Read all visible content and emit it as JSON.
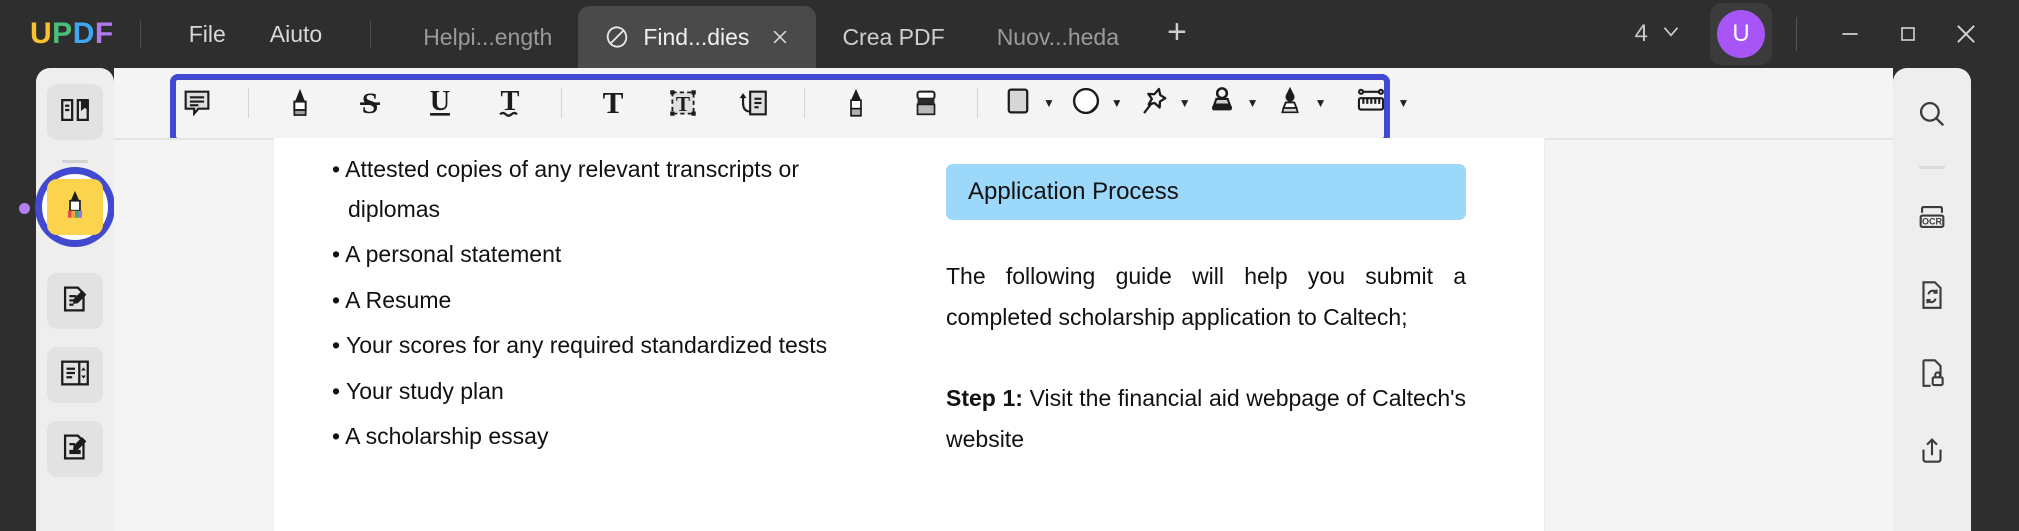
{
  "app": {
    "brand": "UPDF",
    "brand_letters": [
      "U",
      "P",
      "D",
      "F"
    ]
  },
  "titlebar": {
    "menus": [
      {
        "label": "File",
        "name": "menu-file"
      },
      {
        "label": "Aiuto",
        "name": "menu-aiuto"
      }
    ],
    "tabs": [
      {
        "label": "Helpi...ength",
        "active": false
      },
      {
        "label": "Find...dies",
        "active": true,
        "close": "✕"
      },
      {
        "label": "Crea PDF",
        "active": false
      },
      {
        "label": "Nuov...heda",
        "active": false
      }
    ],
    "new_tab_label": "+",
    "tab_count": "4",
    "tab_count_caret": "∨",
    "avatar_letter": "U",
    "window_controls": {
      "minimize": "—",
      "maximize": "□",
      "close": "✕"
    }
  },
  "left_rail": {
    "items": [
      {
        "name": "sidebar-item-reader",
        "icon": "book-bookmark-icon",
        "active": false
      },
      {
        "name": "sidebar-item-comment",
        "icon": "highlighter-marker-icon",
        "active": true
      },
      {
        "name": "sidebar-item-edit-pdf",
        "icon": "document-pen-icon",
        "active": false
      },
      {
        "name": "sidebar-item-page-tools",
        "icon": "page-organize-icon",
        "active": false
      },
      {
        "name": "sidebar-item-fill-sign",
        "icon": "form-sign-icon",
        "active": false
      }
    ]
  },
  "right_rail": {
    "items": [
      {
        "name": "search-button",
        "icon": "search-icon",
        "label": ""
      },
      {
        "name": "ocr-button",
        "icon": "ocr-icon",
        "label": "OCR"
      },
      {
        "name": "convert-button",
        "icon": "convert-document-icon",
        "label": ""
      },
      {
        "name": "protect-button",
        "icon": "document-lock-icon",
        "label": ""
      },
      {
        "name": "share-button",
        "icon": "share-upload-icon",
        "label": ""
      }
    ]
  },
  "annotation_toolbar": {
    "highlighted": true,
    "highlight_color": "#4049d0",
    "tools": [
      {
        "name": "sticky-note-tool",
        "icon": "sticky-note-icon",
        "caret": false
      },
      {
        "name": "highlight-tool",
        "icon": "highlighter-icon",
        "caret": false
      },
      {
        "name": "strikethrough-tool",
        "icon": "strikethrough-S-icon",
        "caret": false
      },
      {
        "name": "underline-tool",
        "icon": "underline-U-icon",
        "caret": false
      },
      {
        "name": "squiggly-tool",
        "icon": "squiggly-T-icon",
        "caret": false
      },
      {
        "name": "text-box-tool",
        "icon": "text-T-icon",
        "caret": false
      },
      {
        "name": "text-field-tool",
        "icon": "text-box-selected-icon",
        "caret": false
      },
      {
        "name": "text-callout-tool",
        "icon": "text-callout-icon",
        "caret": false
      },
      {
        "name": "pencil-tool",
        "icon": "pencil-icon",
        "caret": false
      },
      {
        "name": "eraser-tool",
        "icon": "eraser-icon",
        "caret": false
      },
      {
        "name": "shape-tool",
        "icon": "rectangle-shape-icon",
        "caret": true
      },
      {
        "name": "sticker-tool",
        "icon": "sticker-circle-icon",
        "caret": true
      },
      {
        "name": "pin-tool",
        "icon": "pushpin-icon",
        "caret": true
      },
      {
        "name": "stamp-tool",
        "icon": "stamp-icon",
        "caret": true
      },
      {
        "name": "signature-tool",
        "icon": "fountain-pen-icon",
        "caret": true
      },
      {
        "name": "measure-tool",
        "icon": "ruler-measure-icon",
        "caret": true
      }
    ]
  },
  "document": {
    "left_column": {
      "bullets": [
        {
          "text": "• Attested copies of any relevant transcripts or",
          "indent_line": "diplomas"
        },
        {
          "text": "• A personal statement",
          "indent_line": ""
        },
        {
          "text": "• A Resume",
          "indent_line": ""
        },
        {
          "text": "• Your scores for any required standardized tests",
          "indent_line": ""
        },
        {
          "text": "• Your study plan",
          "indent_line": ""
        },
        {
          "text": "• A scholarship essay",
          "indent_line": ""
        }
      ]
    },
    "right_column": {
      "heading": "Application Process",
      "heading_highlight_color": "#9bd8fa",
      "paragraph1": "The following guide will help you submit a completed scholarship application to Caltech;",
      "step_label": "Step 1:",
      "step_text": " Visit the financial aid webpage of Caltech's website"
    }
  }
}
